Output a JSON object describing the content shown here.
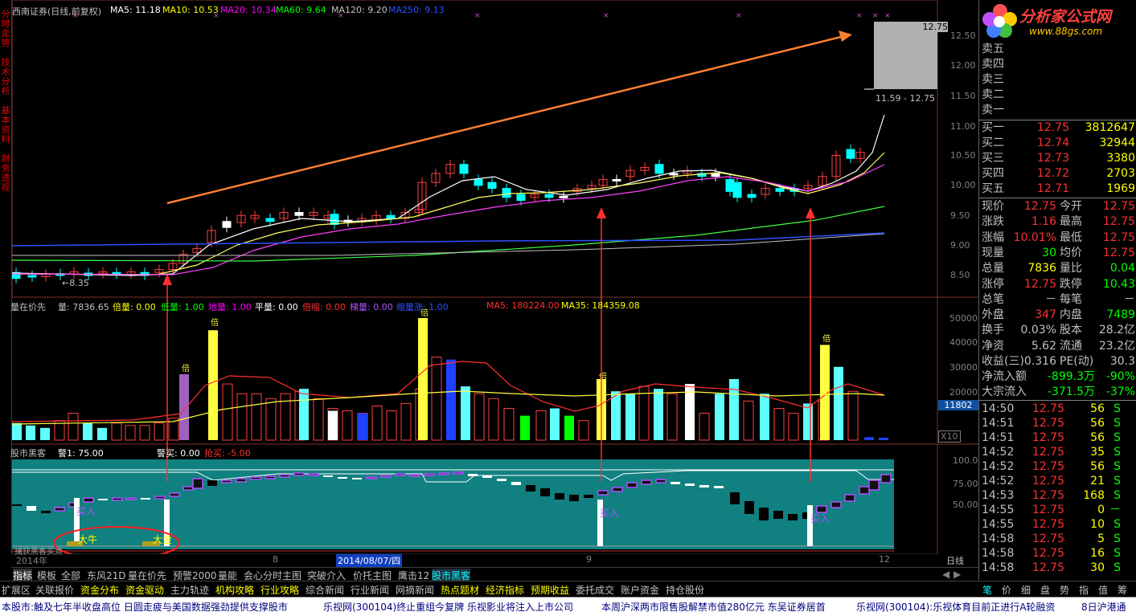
{
  "left_tabs": [
    "分时走势",
    "技术分析",
    "基本资料",
    "财务透视"
  ],
  "header": {
    "title": "西南证券(日线,前复权)",
    "ma5": "MA5: 11.18",
    "ma10": "MA10: 10.53",
    "ma20": "MA20: 10.34",
    "ma60": "MA60: 9.64",
    "ma120": "MA120: 9.20",
    "ma250": "MA250: 9.13"
  },
  "price_axis": [
    "12.75",
    "12.50",
    "12.00",
    "11.50",
    "11.00",
    "10.50",
    "10.00",
    "9.50",
    "9.00",
    "8.50"
  ],
  "price_labels": {
    "range": "11.59 - 12.75",
    "current": "12.75",
    "low_marker": "←8.35"
  },
  "vol_header": {
    "name": "量在价先",
    "liang": "量: 7836.65",
    "bei": "倍量: 0.00",
    "di": "低量: 1.00",
    "di_color": "#00ff00",
    "dij": "地量: 1.00",
    "ping": "平量: 0.00",
    "suo": "倍缩: 0.00",
    "ti": "梯量: 0.00",
    "shrink": "缩量涨: 1.00",
    "ma5": "MA5: 180224.00",
    "ma35": "MA35: 184359.08"
  },
  "vol_axis": [
    "50000",
    "40000",
    "30000",
    "20000",
    "10000"
  ],
  "vol_current": "11802",
  "vol_unit": "X10",
  "bei_label": "倍",
  "ind_header": {
    "name": "股市黑客",
    "alert1": "警1: 75.00",
    "buy_alert": "警买: 0.00",
    "grab": "抢买: -5.00"
  },
  "ind_axis": [
    "100.0",
    "75.00",
    "50.00"
  ],
  "ind_labels": {
    "buy": "买入",
    "bull": "大牛",
    "big": "大金",
    "note": "捕获黑客买点"
  },
  "date_axis": {
    "year": "2014年",
    "m8": "8",
    "date": "2014/08/07/四",
    "m9": "9",
    "m12": "12",
    "period": "日线"
  },
  "tabs": [
    "指标",
    "模板",
    "全部",
    "东风21D",
    "量在价先",
    "预警2000",
    "量能",
    "会心分时主图",
    "突破介入",
    "价托主图",
    "鹰击12",
    "股市黑客"
  ],
  "menus": [
    "扩展区",
    "关联报价",
    "资金分布",
    "资金驱动",
    "主力轨迹",
    "机构攻略",
    "行业攻略",
    "综合新闻",
    "行业新闻",
    "网摘新闻",
    "热点题材",
    "经济指标",
    "预期收益",
    "委托成交",
    "账户资金",
    "持仓股份"
  ],
  "right_menu": [
    "笔",
    "价",
    "细",
    "盘",
    "势",
    "指",
    "值",
    "筹"
  ],
  "right_menu_top": [
    "抬",
    "换"
  ],
  "ticker": [
    "本股市:触及七年半收盘高位 日圆走疲与美国数据强劲提供支撑股市",
    "乐视网(300104)终止重组今复牌 乐视影业将注入上市公司",
    "本周沪深两市限售股解禁市值280亿元 东吴证券居首",
    "乐视网(300104):乐视体育目前正进行A轮融资",
    "8日沪港通"
  ],
  "logo": {
    "text": "分析家公式网",
    "url": "www.88gs.com"
  },
  "sell": [
    {
      "label": "卖五"
    },
    {
      "label": "卖四"
    },
    {
      "label": "卖三"
    },
    {
      "label": "卖二"
    },
    {
      "label": "卖一"
    }
  ],
  "buy": [
    {
      "label": "买一",
      "price": "12.75",
      "vol": "3812647"
    },
    {
      "label": "买二",
      "price": "12.74",
      "vol": "32944"
    },
    {
      "label": "买三",
      "price": "12.73",
      "vol": "3380"
    },
    {
      "label": "买四",
      "price": "12.72",
      "vol": "2703"
    },
    {
      "label": "买五",
      "price": "12.71",
      "vol": "1969"
    }
  ],
  "quote": [
    {
      "a": "现价",
      "av": "12.75",
      "b": "今开",
      "bv": "12.75",
      "ac": "#ff3030",
      "bc": "#ff3030"
    },
    {
      "a": "涨跌",
      "av": "1.16",
      "b": "最高",
      "bv": "12.75",
      "ac": "#ff3030",
      "bc": "#ff3030"
    },
    {
      "a": "涨幅",
      "av": "10.01%",
      "b": "最低",
      "bv": "12.75",
      "ac": "#ff3030",
      "bc": "#ff3030"
    },
    {
      "a": "现量",
      "av": "30",
      "b": "均价",
      "bv": "12.75",
      "ac": "#00ff00",
      "bc": "#ff3030"
    },
    {
      "a": "总量",
      "av": "7836",
      "b": "量比",
      "bv": "0.04",
      "ac": "#ffff00",
      "bc": "#00ff00"
    },
    {
      "a": "涨停",
      "av": "12.75",
      "b": "跌停",
      "bv": "10.43",
      "ac": "#ff3030",
      "bc": "#00ff00"
    },
    {
      "a": "总笔",
      "av": "－",
      "b": "每笔",
      "bv": "－",
      "ac": "#c0c0c0",
      "bc": "#c0c0c0"
    },
    {
      "a": "外盘",
      "av": "347",
      "b": "内盘",
      "bv": "7489",
      "ac": "#ff3030",
      "bc": "#00ff00"
    },
    {
      "a": "换手",
      "av": "0.03%",
      "b": "股本",
      "bv": "28.2亿",
      "ac": "#c0c0c0",
      "bc": "#c0c0c0"
    },
    {
      "a": "净资",
      "av": "5.62",
      "b": "流通",
      "bv": "23.2亿",
      "ac": "#c0c0c0",
      "bc": "#c0c0c0"
    },
    {
      "a": "收益(三)",
      "av": "0.316",
      "b": "PE(动)",
      "bv": "30.3",
      "ac": "#c0c0c0",
      "bc": "#c0c0c0"
    }
  ],
  "flow": [
    {
      "label": "净流入额",
      "val": "-899.3万",
      "pct": "-90%"
    },
    {
      "label": "大宗流入",
      "val": "-371.5万",
      "pct": "-37%"
    }
  ],
  "ticks": [
    {
      "t": "14:50",
      "p": "12.75",
      "v": "56",
      "s": "S"
    },
    {
      "t": "14:51",
      "p": "12.75",
      "v": "56",
      "s": "S"
    },
    {
      "t": "14:51",
      "p": "12.75",
      "v": "56",
      "s": "S"
    },
    {
      "t": "14:52",
      "p": "12.75",
      "v": "35",
      "s": "S"
    },
    {
      "t": "14:52",
      "p": "12.75",
      "v": "56",
      "s": "S"
    },
    {
      "t": "14:52",
      "p": "12.75",
      "v": "21",
      "s": "S"
    },
    {
      "t": "14:53",
      "p": "12.75",
      "v": "168",
      "s": "S"
    },
    {
      "t": "14:55",
      "p": "12.75",
      "v": "0",
      "s": "－"
    },
    {
      "t": "14:55",
      "p": "12.75",
      "v": "10",
      "s": "S"
    },
    {
      "t": "14:58",
      "p": "12.75",
      "v": "5",
      "s": "S"
    },
    {
      "t": "14:58",
      "p": "12.75",
      "v": "16",
      "s": "S"
    },
    {
      "t": "14:58",
      "p": "12.75",
      "v": "30",
      "s": "S"
    }
  ]
}
